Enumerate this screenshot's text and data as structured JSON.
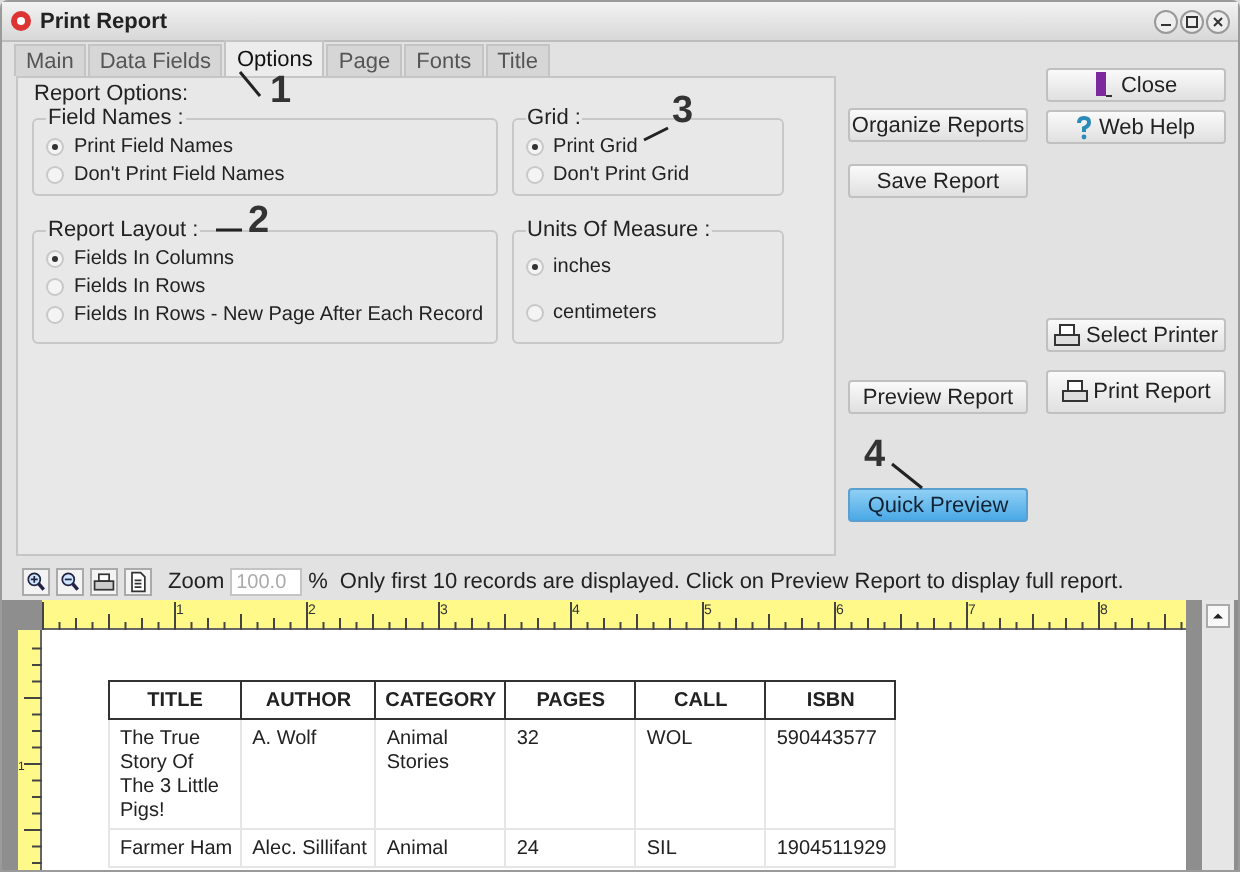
{
  "window": {
    "title": "Print Report"
  },
  "tabs": [
    {
      "label": "Main",
      "selected": false
    },
    {
      "label": "Data Fields",
      "selected": false
    },
    {
      "label": "Options",
      "selected": true
    },
    {
      "label": "Page",
      "selected": false
    },
    {
      "label": "Fonts",
      "selected": false
    },
    {
      "label": "Title",
      "selected": false
    }
  ],
  "options": {
    "title": "Report Options:",
    "groups": [
      {
        "title": "Field Names :",
        "options": [
          {
            "label": "Print Field Names",
            "selected": true
          },
          {
            "label": "Don't Print Field Names",
            "selected": false
          }
        ]
      },
      {
        "title": "Grid :",
        "options": [
          {
            "label": "Print Grid",
            "selected": true
          },
          {
            "label": "Don't Print Grid",
            "selected": false
          }
        ]
      },
      {
        "title": "Report Layout :",
        "options": [
          {
            "label": "Fields In Columns",
            "selected": true
          },
          {
            "label": "Fields In Rows",
            "selected": false
          },
          {
            "label": "Fields In Rows - New Page After Each Record",
            "selected": false
          }
        ]
      },
      {
        "title": "Units Of Measure :",
        "options": [
          {
            "label": "inches",
            "selected": true
          },
          {
            "label": "centimeters",
            "selected": false
          }
        ]
      }
    ]
  },
  "buttons_left": [
    {
      "label": "Organize Reports",
      "kind": "plain"
    },
    {
      "label": "Save Report",
      "kind": "plain"
    },
    {
      "label": "Preview Report",
      "kind": "plain"
    },
    {
      "label": "Quick Preview",
      "kind": "primary"
    }
  ],
  "buttons_right": [
    {
      "label": "Close"
    },
    {
      "label": "Web Help"
    },
    {
      "label": "Select Printer"
    },
    {
      "label": "Print Report"
    }
  ],
  "annotations": [
    {
      "label": "1"
    },
    {
      "label": "2"
    },
    {
      "label": "3"
    },
    {
      "label": "4"
    }
  ],
  "toolbar": {
    "zoom_label": "Zoom",
    "zoom_value": "100.0",
    "zoom_disabled": true,
    "unit": "%",
    "message": "Only first 10 records are displayed. Click on Preview Report to display full report."
  },
  "ruler": {
    "marks": [
      "1",
      "2",
      "3",
      "4",
      "5",
      "6",
      "7",
      "8"
    ],
    "side_marks": [
      "1"
    ]
  },
  "table": {
    "columns": [
      "TITLE",
      "AUTHOR",
      "CATEGORY",
      "PAGES",
      "CALL",
      "ISBN"
    ],
    "rows": [
      [
        "The True Story Of The 3 Little Pigs!",
        "A. Wolf",
        "Animal Stories",
        "32",
        "WOL",
        "590443577"
      ],
      [
        "Farmer Ham",
        "Alec. Sillifant",
        "Animal",
        "24",
        "SIL",
        "1904511929"
      ]
    ]
  }
}
